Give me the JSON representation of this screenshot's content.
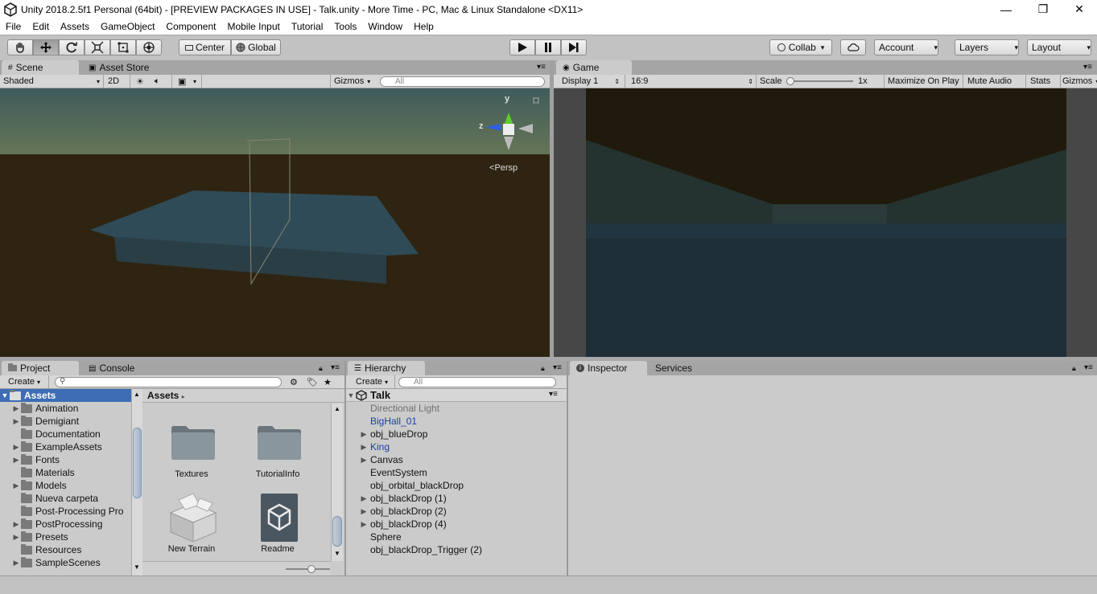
{
  "window": {
    "title": "Unity 2018.2.5f1 Personal (64bit) - [PREVIEW PACKAGES IN USE] - Talk.unity - More Time - PC, Mac & Linux Standalone <DX11>",
    "minimize": "—",
    "restore": "❐",
    "close": "✕"
  },
  "menu": [
    "File",
    "Edit",
    "Assets",
    "GameObject",
    "Component",
    "Mobile Input",
    "Tutorial",
    "Tools",
    "Window",
    "Help"
  ],
  "toolbar": {
    "pivot": "Center",
    "space": "Global",
    "collab": "Collab",
    "account": "Account",
    "layers": "Layers",
    "layout": "Layout"
  },
  "scene": {
    "tab_scene": "Scene",
    "tab_store": "Asset Store",
    "shading": "Shaded",
    "mode2d": "2D",
    "gizmos": "Gizmos",
    "search_placeholder": "All",
    "persp": "Persp",
    "axis_y": "y",
    "axis_z": "z"
  },
  "game": {
    "tab": "Game",
    "display": "Display 1",
    "aspect": "16:9",
    "scale_label": "Scale",
    "scale_value": "1x",
    "maximize": "Maximize On Play",
    "mute": "Mute Audio",
    "stats": "Stats",
    "gizmos": "Gizmos"
  },
  "project": {
    "tab_project": "Project",
    "tab_console": "Console",
    "create": "Create",
    "root": "Assets",
    "tree": [
      {
        "label": "Animation",
        "expandable": true
      },
      {
        "label": "Demigiant",
        "expandable": true
      },
      {
        "label": "Documentation",
        "expandable": false
      },
      {
        "label": "ExampleAssets",
        "expandable": true
      },
      {
        "label": "Fonts",
        "expandable": true
      },
      {
        "label": "Materials",
        "expandable": false
      },
      {
        "label": "Models",
        "expandable": true
      },
      {
        "label": "Nueva carpeta",
        "expandable": false
      },
      {
        "label": "Post-Processing Pro",
        "expandable": false
      },
      {
        "label": "PostProcessing",
        "expandable": true
      },
      {
        "label": "Presets",
        "expandable": true
      },
      {
        "label": "Resources",
        "expandable": false
      },
      {
        "label": "SampleScenes",
        "expandable": true
      }
    ],
    "breadcrumb": "Assets",
    "items": [
      "Textures",
      "TutorialInfo",
      "New Terrain",
      "Readme"
    ]
  },
  "hierarchy": {
    "tab": "Hierarchy",
    "create": "Create",
    "search_placeholder": "All",
    "scene_name": "Talk",
    "items": [
      {
        "label": "Directional Light",
        "expandable": false,
        "style": "disabled"
      },
      {
        "label": "BigHall_01",
        "expandable": false,
        "style": "prefab"
      },
      {
        "label": "obj_blueDrop",
        "expandable": true,
        "style": "normal"
      },
      {
        "label": "King",
        "expandable": true,
        "style": "prefab"
      },
      {
        "label": "Canvas",
        "expandable": true,
        "style": "normal"
      },
      {
        "label": "EventSystem",
        "expandable": false,
        "style": "normal"
      },
      {
        "label": "obj_orbital_blackDrop",
        "expandable": false,
        "style": "normal"
      },
      {
        "label": "obj_blackDrop (1)",
        "expandable": true,
        "style": "normal"
      },
      {
        "label": "obj_blackDrop (2)",
        "expandable": true,
        "style": "normal"
      },
      {
        "label": "obj_blackDrop (4)",
        "expandable": true,
        "style": "normal"
      },
      {
        "label": "Sphere",
        "expandable": false,
        "style": "normal"
      },
      {
        "label": "obj_blackDrop_Trigger (2)",
        "expandable": false,
        "style": "normal"
      }
    ]
  },
  "inspector": {
    "tab_inspector": "Inspector",
    "tab_services": "Services"
  }
}
